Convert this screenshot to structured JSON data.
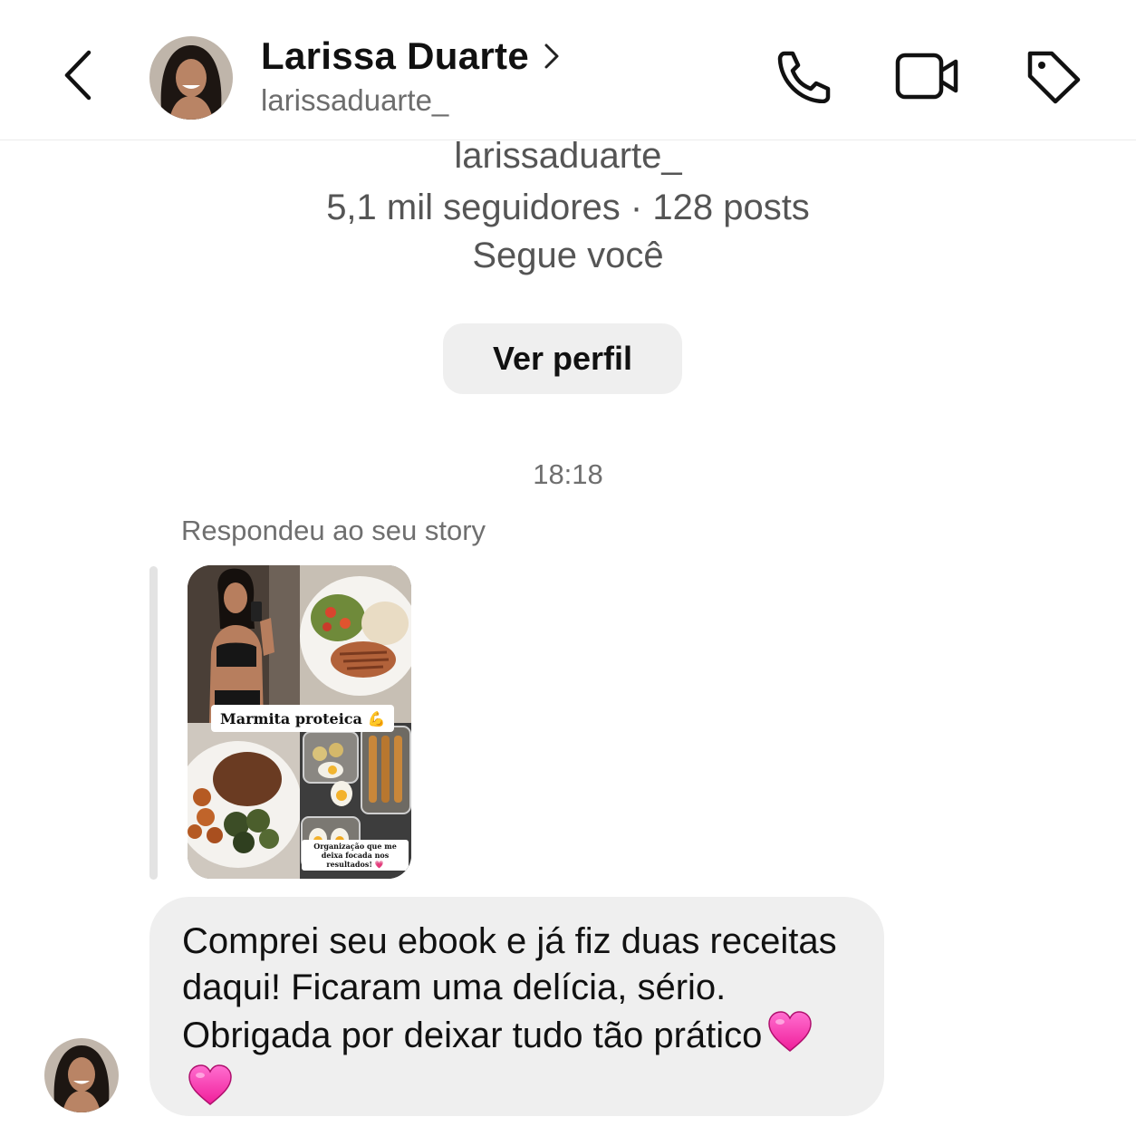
{
  "header": {
    "name": "Larissa Duarte",
    "username": "larissaduarte_"
  },
  "profile": {
    "username": "larissaduarte_",
    "stats": "5,1 mil seguidores · 128 posts",
    "follows_status": "Segue você",
    "view_profile_label": "Ver perfil"
  },
  "conversation": {
    "timestamp": "18:18",
    "reply_context": "Respondeu ao seu story",
    "story": {
      "label": "Marmita proteica 💪",
      "caption": "Organização que me deixa focada nos resultados! 💗"
    },
    "message": {
      "text": "Comprei seu ebook e já fiz duas receitas daqui! Ficaram uma delícia, sério. Obrigada por deixar tudo tão prático",
      "emoji": [
        "pink-heart",
        "pink-heart"
      ]
    }
  },
  "icons": [
    "back-arrow",
    "chevron-right",
    "phone",
    "video-camera",
    "tag"
  ],
  "colors": {
    "secondary_text": "#6f6f6f",
    "bubble_bg": "#efefef",
    "button_bg": "#efefef",
    "heart": "#ff3fb0"
  }
}
